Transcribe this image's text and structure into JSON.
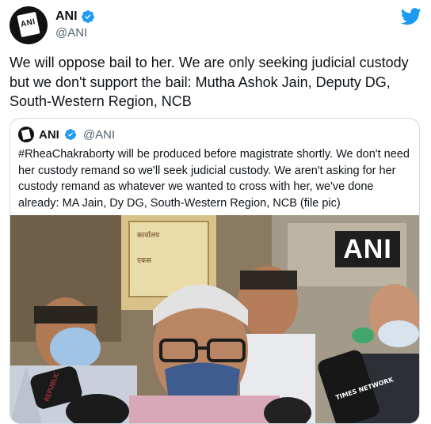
{
  "tweet": {
    "author_name": "ANI",
    "author_handle": "@ANI",
    "text": "We will oppose bail to her. We are only seeking judicial custody but we don't support the bail: Mutha Ashok Jain, Deputy DG, South-Western Region, NCB",
    "avatar_icon": "ani-logo-icon",
    "verified_icon": "verified-badge-icon",
    "platform_icon": "twitter-bird-icon"
  },
  "quoted_tweet": {
    "author_name": "ANI",
    "author_handle": "@ANI",
    "text": "#RheaChakraborty will be produced before magistrate shortly. We don't need her custody remand so we'll seek judicial custody. We aren't asking for her custody remand as whatever we wanted to cross with her, we've done already: MA Jain, Dy DG, South-Western Region, NCB (file pic)",
    "image": {
      "watermark": "ANI",
      "mic_labels": [
        "TIMES NETWORK",
        "REPUBLIC"
      ],
      "sign_text": [
        "एकस",
        "कार्यालय"
      ]
    }
  },
  "colors": {
    "twitter_blue": "#1d9bf0",
    "text_primary": "#0f1419",
    "text_secondary": "#536471",
    "border": "#cfd9de"
  }
}
